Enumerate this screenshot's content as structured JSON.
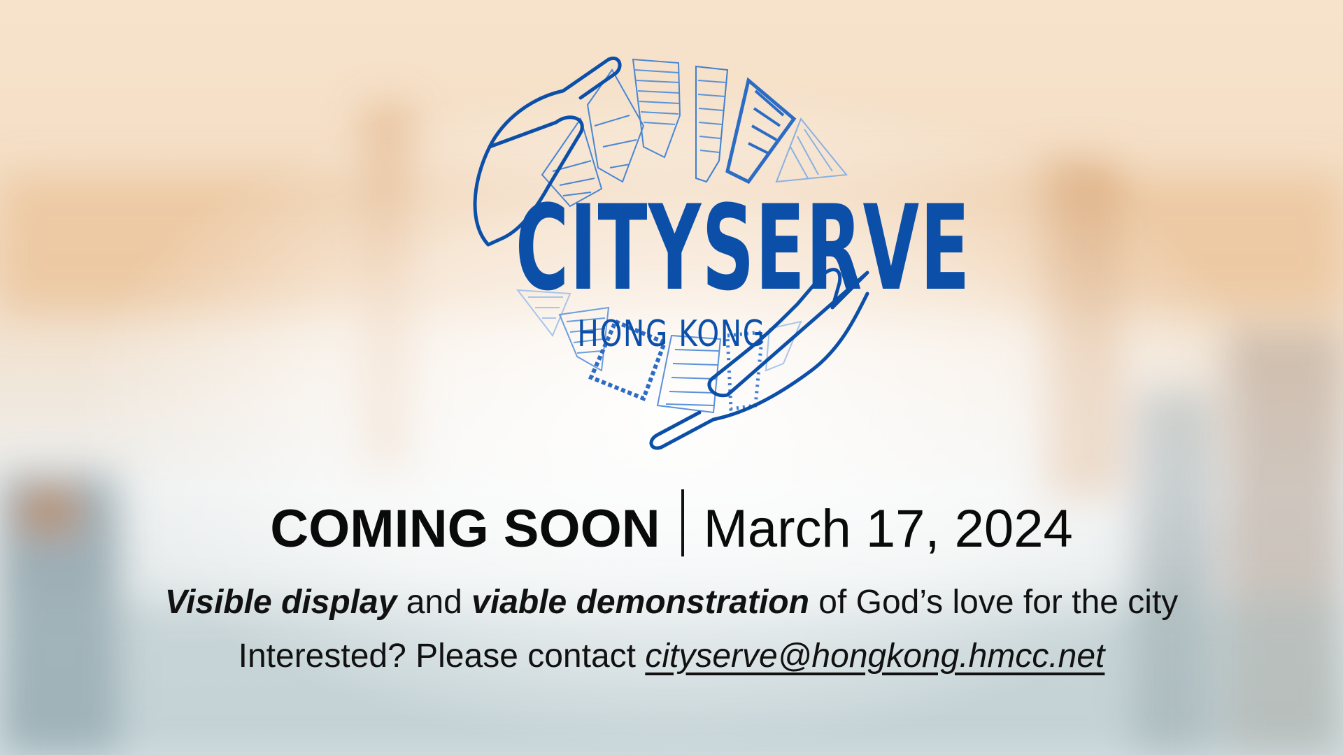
{
  "logo": {
    "title": "CITYSERVE",
    "subtitle": "HONG KONG",
    "colors": {
      "primary": "#0b4fa8",
      "light": "#6a9ad8"
    },
    "icons": [
      "left-hand-icon",
      "right-hand-icon",
      "skyline-icon"
    ]
  },
  "announcement": {
    "coming_soon": "COMING SOON",
    "date": "March 17, 2024"
  },
  "tagline": {
    "part1": "Visible display",
    "part2": " and ",
    "part3": "viable demonstration",
    "part4": " of God’s love for the city"
  },
  "contact": {
    "prefix": "Interested? Please contact ",
    "email": "cityserve@hongkong.hmcc.net"
  }
}
